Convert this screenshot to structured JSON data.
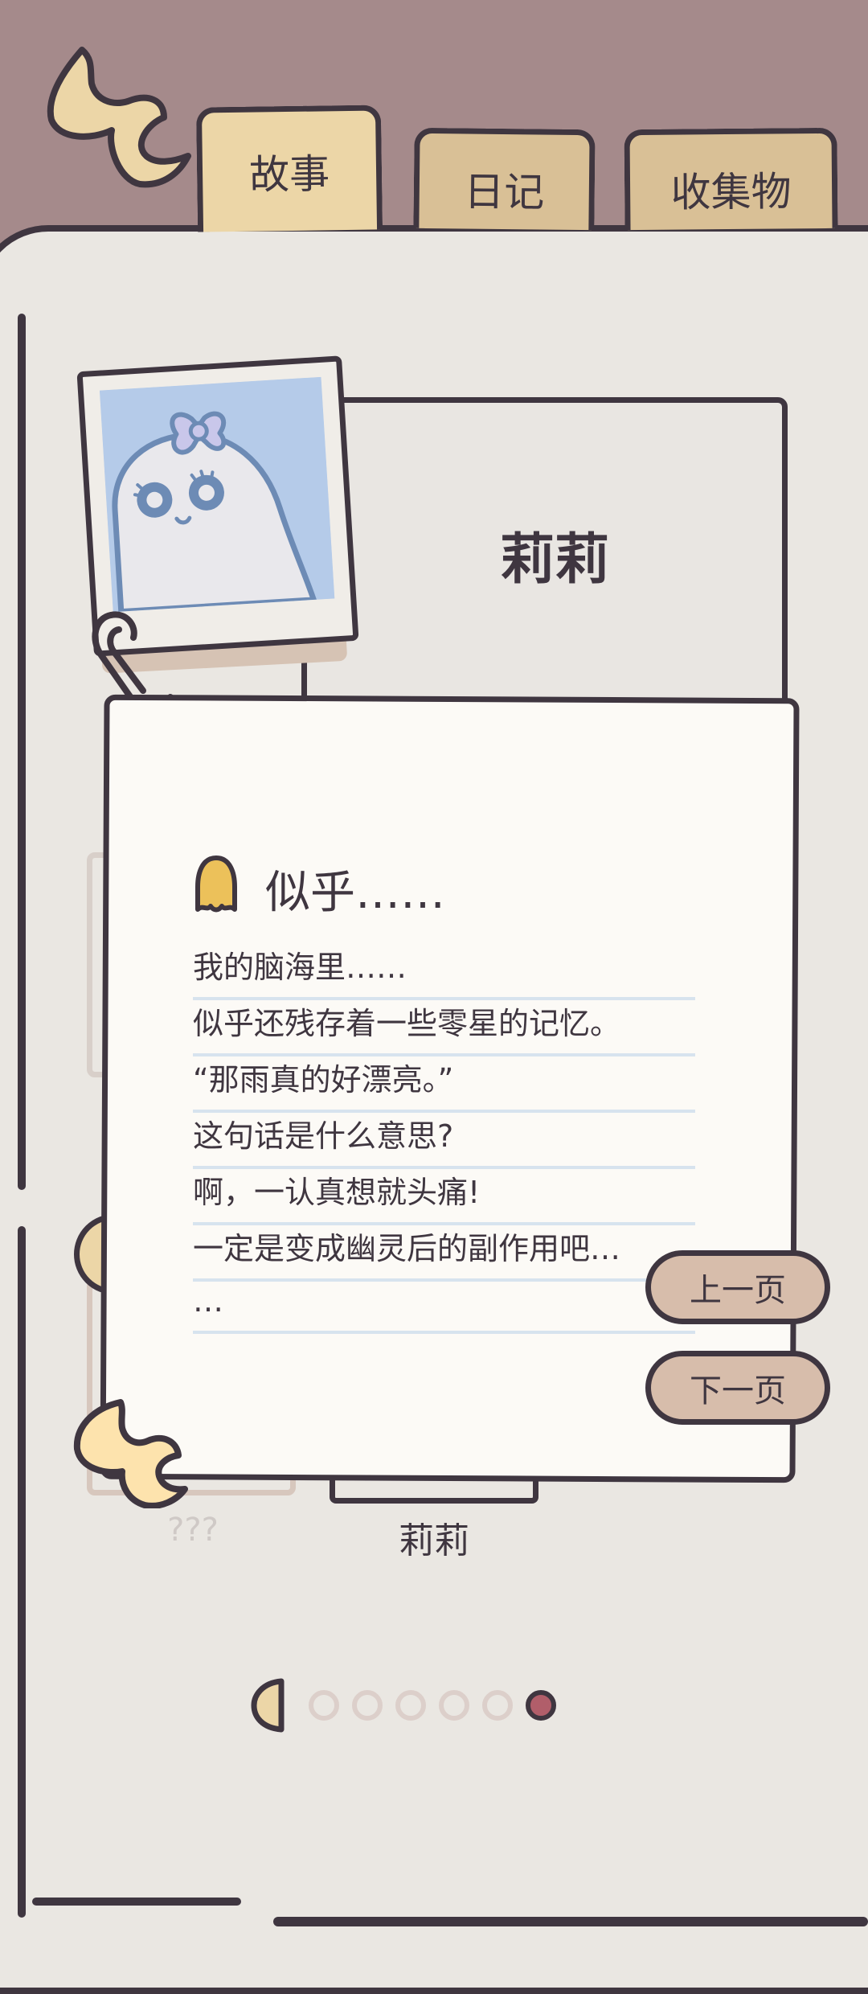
{
  "tabs": [
    {
      "label": "故事"
    },
    {
      "label": "日记"
    },
    {
      "label": "收集物"
    }
  ],
  "character": {
    "name": "莉莉"
  },
  "note": {
    "title": "似乎……",
    "lines": [
      "我的脑海里……",
      "似乎还残存着一些零星的记忆。",
      "“那雨真的好漂亮。”",
      "这句话是什么意思?",
      "啊，一认真想就头痛!",
      "一定是变成幽灵后的副作用吧…",
      "…"
    ]
  },
  "buttons": {
    "prev": "上一页",
    "next": "下一页"
  },
  "gallery": {
    "unknown_label": "???",
    "selected_label": "莉莉"
  },
  "pager": {
    "total": 6,
    "current": 6
  },
  "colors": {
    "background": "#a58a8b",
    "book": "#eae7e2",
    "tab_active": "#ecd6a7",
    "tab_inactive": "#d9c096",
    "button": "#d7bdab",
    "dot_active": "#b15e6a",
    "outline": "#3f3640"
  }
}
